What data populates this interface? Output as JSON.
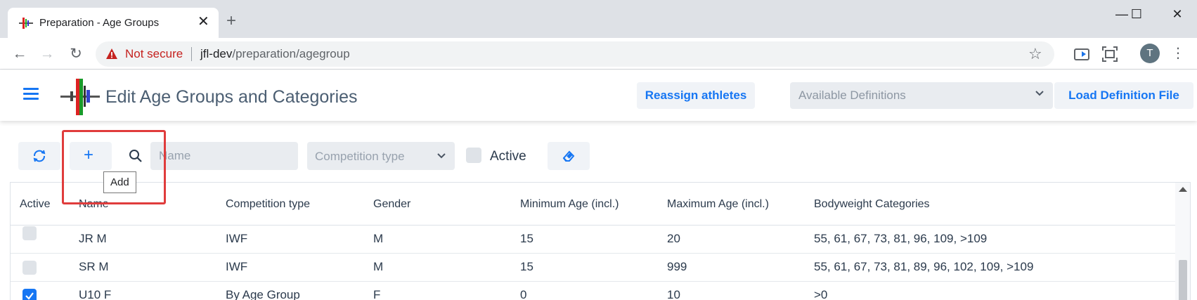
{
  "browser": {
    "tab_title": "Preparation - Age Groups",
    "tab_close": "✕",
    "new_tab": "+",
    "security_label": "Not secure",
    "url_host": "jfl-dev",
    "url_path": "/preparation/agegroup",
    "profile_initial": "T",
    "window_minimize": "—",
    "window_maximize": "☐",
    "window_close": "✕"
  },
  "header": {
    "title": "Edit Age Groups and Categories",
    "reassign_button": "Reassign athletes",
    "definitions_placeholder": "Available Definitions",
    "load_button": "Load Definition File"
  },
  "filters": {
    "name_placeholder": "Name",
    "competition_type_placeholder": "Competition type",
    "active_label": "Active",
    "add_tooltip": "Add"
  },
  "grid": {
    "columns": [
      "Active",
      "Name",
      "Competition type",
      "Gender",
      "Minimum Age (incl.)",
      "Maximum Age (incl.)",
      "Bodyweight Categories"
    ],
    "rows": [
      {
        "active": false,
        "name": "JR M",
        "competition_type": "IWF",
        "gender": "M",
        "min_age": "15",
        "max_age": "20",
        "categories": "55, 61, 67, 73, 81, 96, 109, >109"
      },
      {
        "active": false,
        "name": "SR M",
        "competition_type": "IWF",
        "gender": "M",
        "min_age": "15",
        "max_age": "999",
        "categories": "55, 61, 67, 73, 81, 89, 96, 102, 109, >109"
      },
      {
        "active": true,
        "name": "U10 F",
        "competition_type": "By Age Group",
        "gender": "F",
        "min_age": "0",
        "max_age": "10",
        "categories": ">0"
      }
    ]
  },
  "colors": {
    "accent": "#1676f3",
    "highlight": "#e03c3c",
    "warning": "#c5221f"
  }
}
